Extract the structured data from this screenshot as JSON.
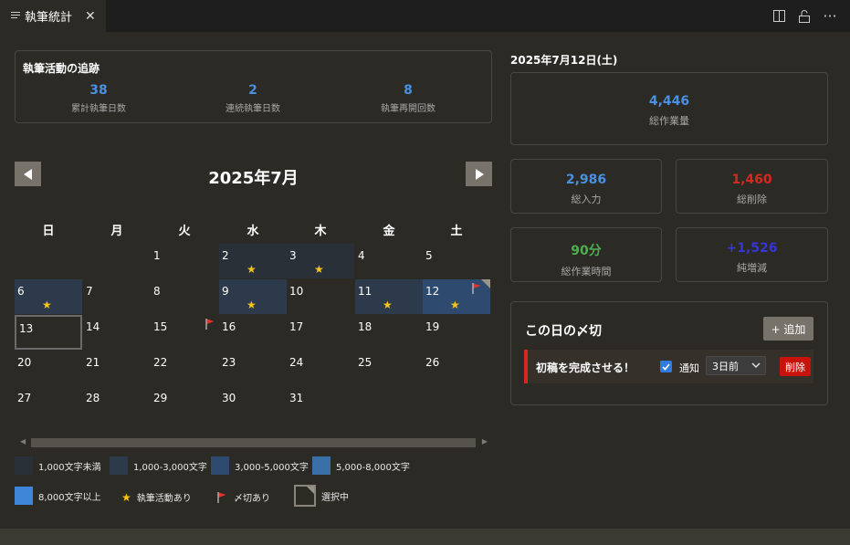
{
  "tab": {
    "title": "執筆統計",
    "close_glyph": "✕"
  },
  "tab_actions": {
    "split_icon": "split-editor-icon",
    "lock_icon": "lock-icon",
    "more_glyph": "···"
  },
  "tracking": {
    "title": "執筆活動の追跡",
    "stats": [
      {
        "value": "38",
        "label": "累計執筆日数"
      },
      {
        "value": "2",
        "label": "連続執筆日数"
      },
      {
        "value": "8",
        "label": "執筆再開回数"
      }
    ]
  },
  "calendar": {
    "month_label": "2025年7月",
    "weekdays": [
      "日",
      "月",
      "火",
      "水",
      "木",
      "金",
      "土"
    ],
    "days": [
      {
        "d": "1",
        "level": 0,
        "star": false,
        "flag": false
      },
      {
        "d": "2",
        "level": 1,
        "star": true,
        "flag": false
      },
      {
        "d": "3",
        "level": 1,
        "star": true,
        "flag": false
      },
      {
        "d": "4",
        "level": 0,
        "star": false,
        "flag": false
      },
      {
        "d": "5",
        "level": 0,
        "star": false,
        "flag": false
      },
      {
        "d": "6",
        "level": 2,
        "star": true,
        "flag": false
      },
      {
        "d": "7",
        "level": 0,
        "star": false,
        "flag": false
      },
      {
        "d": "8",
        "level": 0,
        "star": false,
        "flag": false
      },
      {
        "d": "9",
        "level": 2,
        "star": true,
        "flag": false
      },
      {
        "d": "10",
        "level": 0,
        "star": false,
        "flag": false
      },
      {
        "d": "11",
        "level": 2,
        "star": true,
        "flag": false
      },
      {
        "d": "12",
        "level": 3,
        "star": true,
        "flag": true,
        "selected": true
      },
      {
        "d": "13",
        "level": 0,
        "star": false,
        "flag": false,
        "today": true
      },
      {
        "d": "14",
        "level": 0,
        "star": false,
        "flag": false
      },
      {
        "d": "15",
        "level": 0,
        "star": false,
        "flag": true
      },
      {
        "d": "16",
        "level": 0,
        "star": false,
        "flag": false
      },
      {
        "d": "17",
        "level": 0,
        "star": false,
        "flag": false
      },
      {
        "d": "18",
        "level": 0,
        "star": false,
        "flag": false
      },
      {
        "d": "19",
        "level": 0,
        "star": false,
        "flag": false
      },
      {
        "d": "20",
        "level": 0,
        "star": false,
        "flag": false
      },
      {
        "d": "21",
        "level": 0,
        "star": false,
        "flag": false
      },
      {
        "d": "22",
        "level": 0,
        "star": false,
        "flag": false
      },
      {
        "d": "23",
        "level": 0,
        "star": false,
        "flag": false
      },
      {
        "d": "24",
        "level": 0,
        "star": false,
        "flag": false
      },
      {
        "d": "25",
        "level": 0,
        "star": false,
        "flag": false
      },
      {
        "d": "26",
        "level": 0,
        "star": false,
        "flag": false
      },
      {
        "d": "27",
        "level": 0,
        "star": false,
        "flag": false
      },
      {
        "d": "28",
        "level": 0,
        "star": false,
        "flag": false
      },
      {
        "d": "29",
        "level": 0,
        "star": false,
        "flag": false
      },
      {
        "d": "30",
        "level": 0,
        "star": false,
        "flag": false
      },
      {
        "d": "31",
        "level": 0,
        "star": false,
        "flag": false
      }
    ]
  },
  "legend": {
    "levels": [
      {
        "label": "1,000文字未満",
        "color": "#2a3038"
      },
      {
        "label": "1,000-3,000文字",
        "color": "#2c3a4b"
      },
      {
        "label": "3,000-5,000文字",
        "color": "#2e4b6f"
      },
      {
        "label": "5,000-8,000文字",
        "color": "#3a6fa8"
      },
      {
        "label": "8,000文字以上",
        "color": "#3f87d6"
      }
    ],
    "star_label": "執筆活動あり",
    "flag_label": "〆切あり",
    "selected_label": "選択中"
  },
  "detail": {
    "date": "2025年7月12日(土)",
    "total": {
      "value": "4,446",
      "label": "総作業量",
      "color": "#4a90e2"
    },
    "input": {
      "value": "2,986",
      "label": "総入力",
      "color": "#4a90e2"
    },
    "deleted": {
      "value": "1,460",
      "label": "総削除",
      "color": "#d6281e"
    },
    "time": {
      "value": "90分",
      "label": "総作業時間",
      "color": "#4caf50"
    },
    "net": {
      "value": "+1,526",
      "label": "純増減",
      "color": "#3535d8"
    }
  },
  "deadlines": {
    "title": "この日の〆切",
    "add_label": "+ 追加",
    "items": [
      {
        "name": "初稿を完成させる！",
        "notify_label": "通知",
        "notify_checked": true,
        "timing": "3日前",
        "delete_label": "削除"
      }
    ]
  }
}
